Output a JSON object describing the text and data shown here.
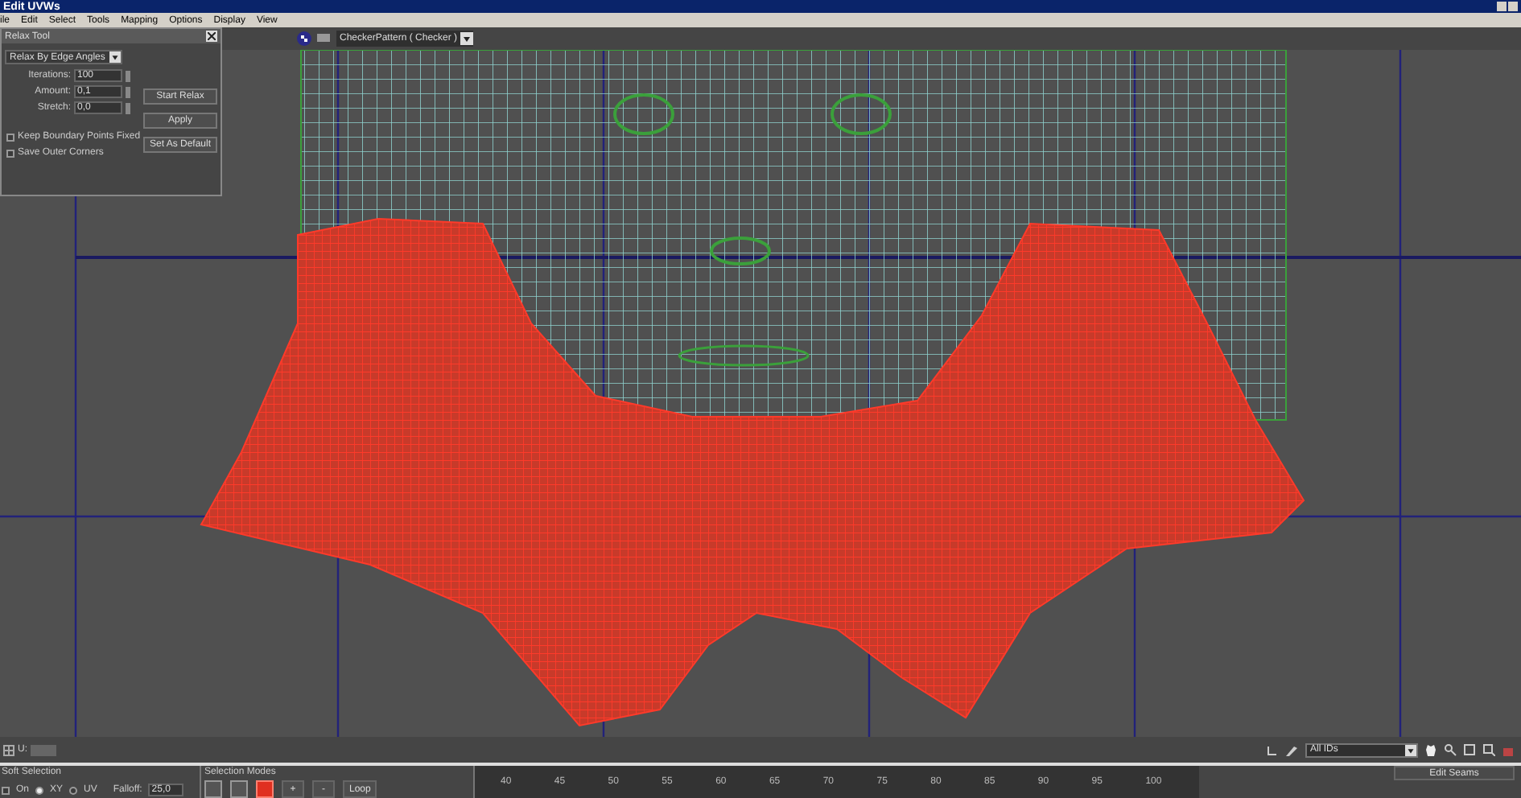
{
  "window": {
    "title": "Edit UVWs"
  },
  "menu": [
    "ile",
    "Edit",
    "Select",
    "Tools",
    "Mapping",
    "Options",
    "Display",
    "View"
  ],
  "toolbar": {
    "texture_dropdown": "CheckerPattern ( Checker )"
  },
  "relax_tool": {
    "title": "Relax Tool",
    "method": "Relax By Edge Angles",
    "fields": [
      {
        "label": "Iterations:",
        "value": "100"
      },
      {
        "label": "Amount:",
        "value": "0,1"
      },
      {
        "label": "Stretch:",
        "value": "0,0"
      }
    ],
    "checkboxes": [
      {
        "label": "Keep Boundary Points Fixed",
        "checked": false
      },
      {
        "label": "Save Outer Corners",
        "checked": false
      }
    ],
    "buttons": [
      "Start Relax",
      "Apply",
      "Set As Default"
    ]
  },
  "u_field": {
    "label": "U:"
  },
  "id_filter": "All IDs",
  "soft_selection": {
    "title": "Soft Selection",
    "on": {
      "label": "On",
      "checked": false
    },
    "radios": [
      {
        "label": "XY",
        "selected": true
      },
      {
        "label": "UV",
        "selected": false
      }
    ],
    "falloff": {
      "label": "Falloff:",
      "value": "25,0"
    }
  },
  "selection_modes": {
    "title": "Selection Modes",
    "modes": [
      {
        "selected": false
      },
      {
        "selected": false
      },
      {
        "selected": true
      }
    ],
    "buttons": [
      "+",
      "-",
      "Loop"
    ]
  },
  "ruler": [
    "40",
    "45",
    "50",
    "55",
    "60",
    "65",
    "70",
    "75",
    "80",
    "85",
    "90",
    "95",
    "100"
  ],
  "edit_seams": "Edit Seams"
}
